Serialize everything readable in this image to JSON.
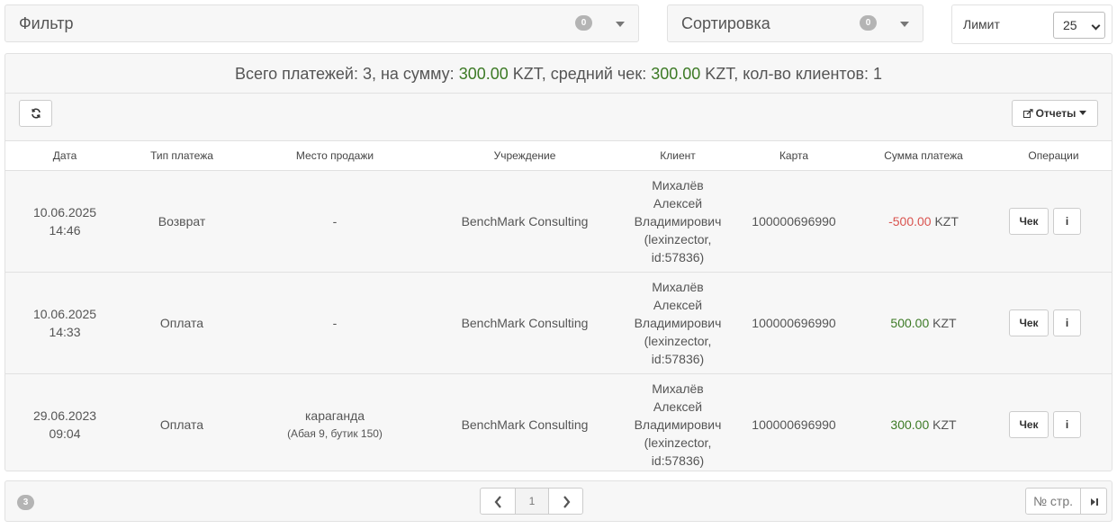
{
  "filter": {
    "label": "Фильтр",
    "count": "0"
  },
  "sort": {
    "label": "Сортировка",
    "count": "0"
  },
  "limit": {
    "label": "Лимит",
    "value": "25"
  },
  "summary": {
    "prefix": "Всего платежей: 3, на сумму: ",
    "total": "300.00",
    "mid1": " KZT, средний чек: ",
    "avg": "300.00",
    "mid2": " KZT, кол-во клиентов: 1"
  },
  "toolbar": {
    "reports_label": "Отчеты"
  },
  "table": {
    "headers": [
      "Дата",
      "Тип платежа",
      "Место продажи",
      "Учреждение",
      "Клиент",
      "Карта",
      "Сумма платежа",
      "Операции"
    ],
    "rows": [
      {
        "date": "10.06.2025",
        "time": "14:46",
        "type": "Возврат",
        "place": "-",
        "place_sub": "",
        "org": "BenchMark Consulting",
        "client": [
          "Михалёв",
          "Алексей",
          "Владимирович",
          "(lexinzector,",
          "id:57836)"
        ],
        "card": "100000696990",
        "amount": "-500.00",
        "currency": "KZT",
        "amount_color": "#d9534f"
      },
      {
        "date": "10.06.2025",
        "time": "14:33",
        "type": "Оплата",
        "place": "-",
        "place_sub": "",
        "org": "BenchMark Consulting",
        "client": [
          "Михалёв",
          "Алексей",
          "Владимирович",
          "(lexinzector,",
          "id:57836)"
        ],
        "card": "100000696990",
        "amount": "500.00",
        "currency": "KZT",
        "amount_color": "#3c7a25"
      },
      {
        "date": "29.06.2023",
        "time": "09:04",
        "type": "Оплата",
        "place": "караганда",
        "place_sub": "(Абая 9, бутик 150)",
        "org": "BenchMark Consulting",
        "client": [
          "Михалёв",
          "Алексей",
          "Владимирович",
          "(lexinzector,",
          "id:57836)"
        ],
        "card": "100000696990",
        "amount": "300.00",
        "currency": "KZT",
        "amount_color": "#3c7a25"
      }
    ],
    "check_label": "Чек",
    "info_label": "i"
  },
  "footer": {
    "count": "3",
    "page": "1",
    "page_no_label": "№ стр."
  }
}
